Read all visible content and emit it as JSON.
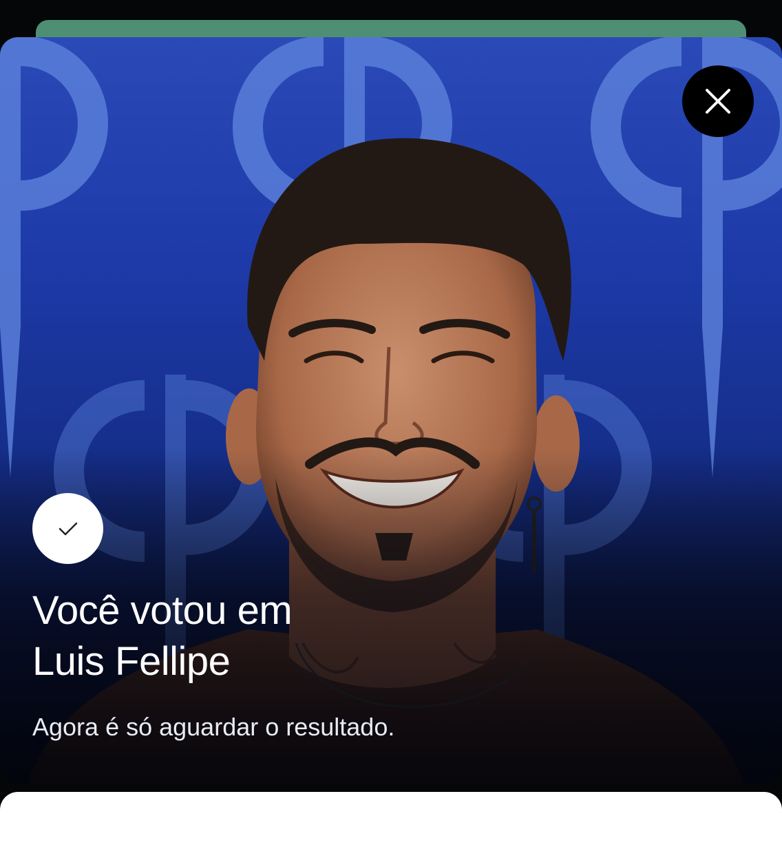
{
  "colors": {
    "accent_green": "#4e8f73",
    "card_blue": "#1d3aa8",
    "pattern_blue": "#5478d4",
    "text_white": "#ffffff"
  },
  "header": {
    "close_icon": "close-icon"
  },
  "vote": {
    "status_icon": "check-icon",
    "title_line1": "Você votou em",
    "title_line2": "Luis Fellipe",
    "subtitle": "Agora é só aguardar o resultado."
  }
}
